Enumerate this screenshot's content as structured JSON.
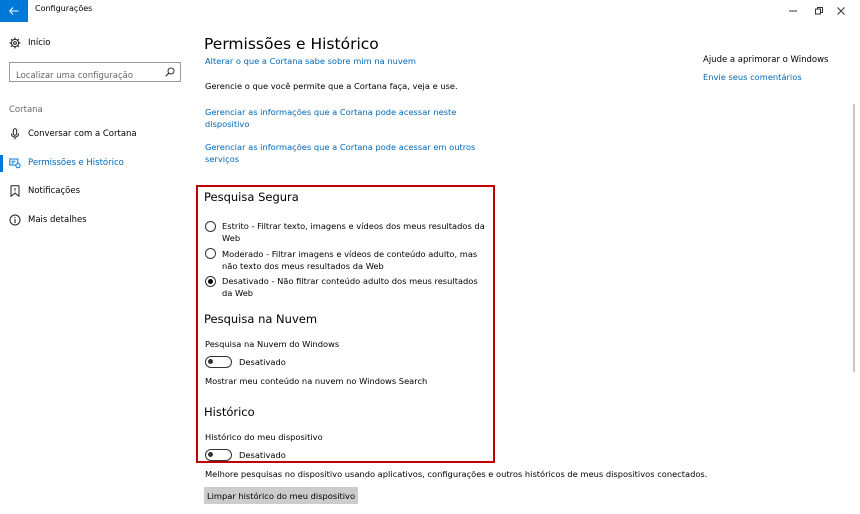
{
  "window": {
    "title": "Configurações"
  },
  "sidebar": {
    "home_label": "Início",
    "search_placeholder": "Localizar uma configuração",
    "section_label": "Cortana",
    "items": [
      {
        "label": "Conversar com a Cortana",
        "icon": "microphone-icon"
      },
      {
        "label": "Permissões e Histórico",
        "icon": "permissions-icon"
      },
      {
        "label": "Notificações",
        "icon": "notifications-icon"
      },
      {
        "label": "Mais detalhes",
        "icon": "info-icon"
      }
    ]
  },
  "main": {
    "title": "Permissões e Histórico",
    "link_cloud": "Alterar o que a Cortana sabe sobre mim na nuvem",
    "manage_text": "Gerencie o que você permite que a Cortana faça, veja e use.",
    "link_device_1": "Gerenciar as informações que a Cortana pode acessar neste",
    "link_device_2": "dispositivo",
    "link_services_1": "Gerenciar as informações que a Cortana pode acessar em outros",
    "link_services_2": "serviços",
    "safe_search": {
      "heading": "Pesquisa Segura",
      "options": [
        {
          "line1": "Estrito - Filtrar texto, imagens e vídeos dos meus resultados da",
          "line2": "Web",
          "checked": false
        },
        {
          "line1": "Moderado - Filtrar imagens e vídeos de conteúdo adulto, mas",
          "line2": "não texto dos meus resultados da Web",
          "checked": false
        },
        {
          "line1": "Desativado - Não filtrar conteúdo adulto dos meus resultados",
          "line2": "da Web",
          "checked": true
        }
      ]
    },
    "cloud_search": {
      "heading": "Pesquisa na Nuvem",
      "label": "Pesquisa na Nuvem do Windows",
      "toggle_state": "Desativado",
      "note": "Mostrar meu conteúdo na nuvem no Windows Search"
    },
    "history": {
      "heading": "Histórico",
      "label": "Histórico do meu dispositivo",
      "toggle_state": "Desativado",
      "description": "Melhore pesquisas no dispositivo usando aplicativos, configurações e outros históricos de meus dispositivos conectados.",
      "clear_button": "Limpar histórico do meu dispositivo"
    }
  },
  "aside": {
    "help_title": "Ajude a aprimorar o Windows",
    "feedback_link": "Envie seus comentários"
  },
  "colors": {
    "accent": "#0078d7",
    "link": "#0067b8",
    "highlight": "#c00000"
  }
}
